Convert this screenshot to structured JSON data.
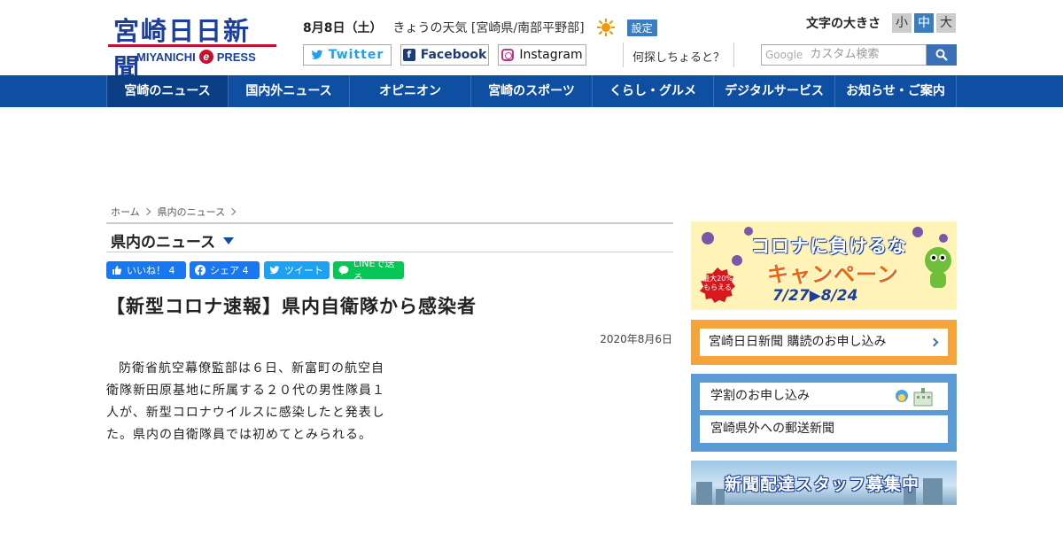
{
  "brand": {
    "name_jp": "宮崎日日新聞",
    "name_en_left": "MIYANICHI",
    "name_en_e": "e",
    "name_en_right": "PRESS",
    "accent": "#0e4fa1",
    "red": "#c8102e"
  },
  "header": {
    "date": "8月8日（土）",
    "weather_label": "きょうの天気 [宮崎県/南部平野部]",
    "weather_icon": "sun-icon",
    "settings_label": "設定",
    "font_size_label": "文字の大きさ",
    "font_sizes": [
      "小",
      "中",
      "大"
    ],
    "font_size_selected": "中",
    "social": {
      "twitter": "Twitter",
      "facebook": "Facebook",
      "instagram": "Instagram"
    },
    "search_hint": "何探しちょると？",
    "search_google": "Google",
    "search_placeholder": "カスタム検索"
  },
  "nav": [
    "宮崎のニュース",
    "国内外ニュース",
    "オピニオン",
    "宮崎のスポーツ",
    "くらし・グルメ",
    "デジタルサービス",
    "お知らせ・ご案内"
  ],
  "breadcrumb": [
    "ホーム",
    "県内のニュース"
  ],
  "section_title": "県内のニュース",
  "share": {
    "like": "いいね！ 4",
    "share": "シェア 4",
    "tweet": "ツイート",
    "line": "LINEで送る"
  },
  "article": {
    "title": "【新型コロナ速報】県内自衛隊から感染者",
    "date": "2020年8月6日",
    "body": "防衛省航空幕僚監部は６日、新富町の航空自衛隊新田原基地に所属する２０代の男性隊員１人が、新型コロナウイルスに感染したと発表した。県内の自衛隊員では初めてとみられる。"
  },
  "sidebar": {
    "corona_banner": {
      "line1": "コロナに負けるな",
      "line2": "キャンペーン",
      "dates": "7/27▶8/24",
      "badge": "最大20%もらえる"
    },
    "subscribe": "宮崎日日新聞 購読のお申し込み",
    "student": "学割のお申し込み",
    "mail": "宮崎県外への郵送新聞",
    "staff": "新聞配達スタッフ募集中"
  }
}
